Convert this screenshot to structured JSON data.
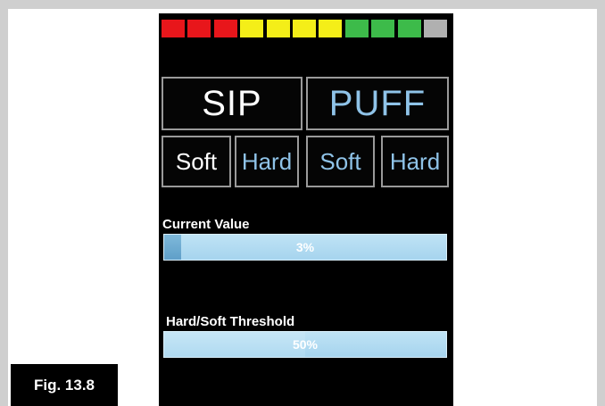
{
  "figure": {
    "label": "Fig. 13.8"
  },
  "meter": {
    "segment_colors": [
      "#e8161b",
      "#e8161b",
      "#e8161b",
      "#f4ee18",
      "#f4ee18",
      "#f4ee18",
      "#f4ee18",
      "#3dbb4a",
      "#3dbb4a",
      "#3dbb4a",
      "#b0b0b0"
    ]
  },
  "modes": {
    "sip_label": "SIP",
    "puff_label": "PUFF",
    "sip_soft_label": "Soft",
    "sip_hard_label": "Hard",
    "puff_soft_label": "Soft",
    "puff_hard_label": "Hard"
  },
  "colors": {
    "sip_text": "#ffffff",
    "puff_text": "#8fc3e8"
  },
  "current_value": {
    "label": "Current Value",
    "percent": 3,
    "text": "3%"
  },
  "threshold": {
    "label": "Hard/Soft Threshold",
    "percent": 50,
    "text": "50%"
  }
}
